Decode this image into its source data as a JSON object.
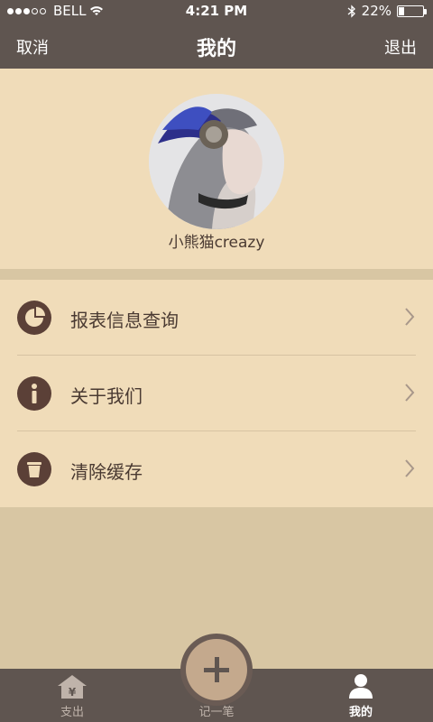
{
  "status_bar": {
    "carrier": "BELL",
    "time": "4:21 PM",
    "battery_percent": "22%",
    "battery_level": 0.22
  },
  "nav": {
    "left": "取消",
    "title": "我的",
    "right": "退出"
  },
  "profile": {
    "username": "小熊猫creazy"
  },
  "menu": {
    "items": [
      {
        "label": "报表信息查询",
        "icon": "pie-chart-icon"
      },
      {
        "label": "关于我们",
        "icon": "info-icon"
      },
      {
        "label": "清除缓存",
        "icon": "trash-icon"
      }
    ]
  },
  "tabs": {
    "expense": "支出",
    "record": "记一笔",
    "mine": "我的"
  },
  "colors": {
    "bar": "#5f5550",
    "panel": "#f0dcb9",
    "background": "#d8c6a3",
    "icon": "#5b4037"
  }
}
